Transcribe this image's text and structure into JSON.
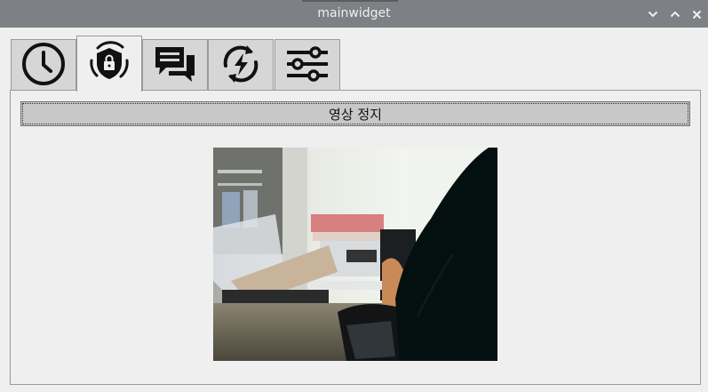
{
  "window": {
    "title": "mainwidget",
    "controls": [
      "minimize-icon",
      "maximize-icon",
      "close-icon"
    ]
  },
  "tabs": [
    {
      "icon": "clock-icon",
      "active": false
    },
    {
      "icon": "shield-lock-icon",
      "active": true
    },
    {
      "icon": "chat-bubbles-icon",
      "active": false
    },
    {
      "icon": "refresh-bolt-icon",
      "active": false
    },
    {
      "icon": "sliders-icon",
      "active": false
    }
  ],
  "main": {
    "stop_button_label": "영상 정지"
  },
  "colors": {
    "titlebar": "#7d8084",
    "window_bg": "#efefef",
    "button_bg": "#c8c8c8",
    "tab_inactive": "#d6d6d6"
  }
}
